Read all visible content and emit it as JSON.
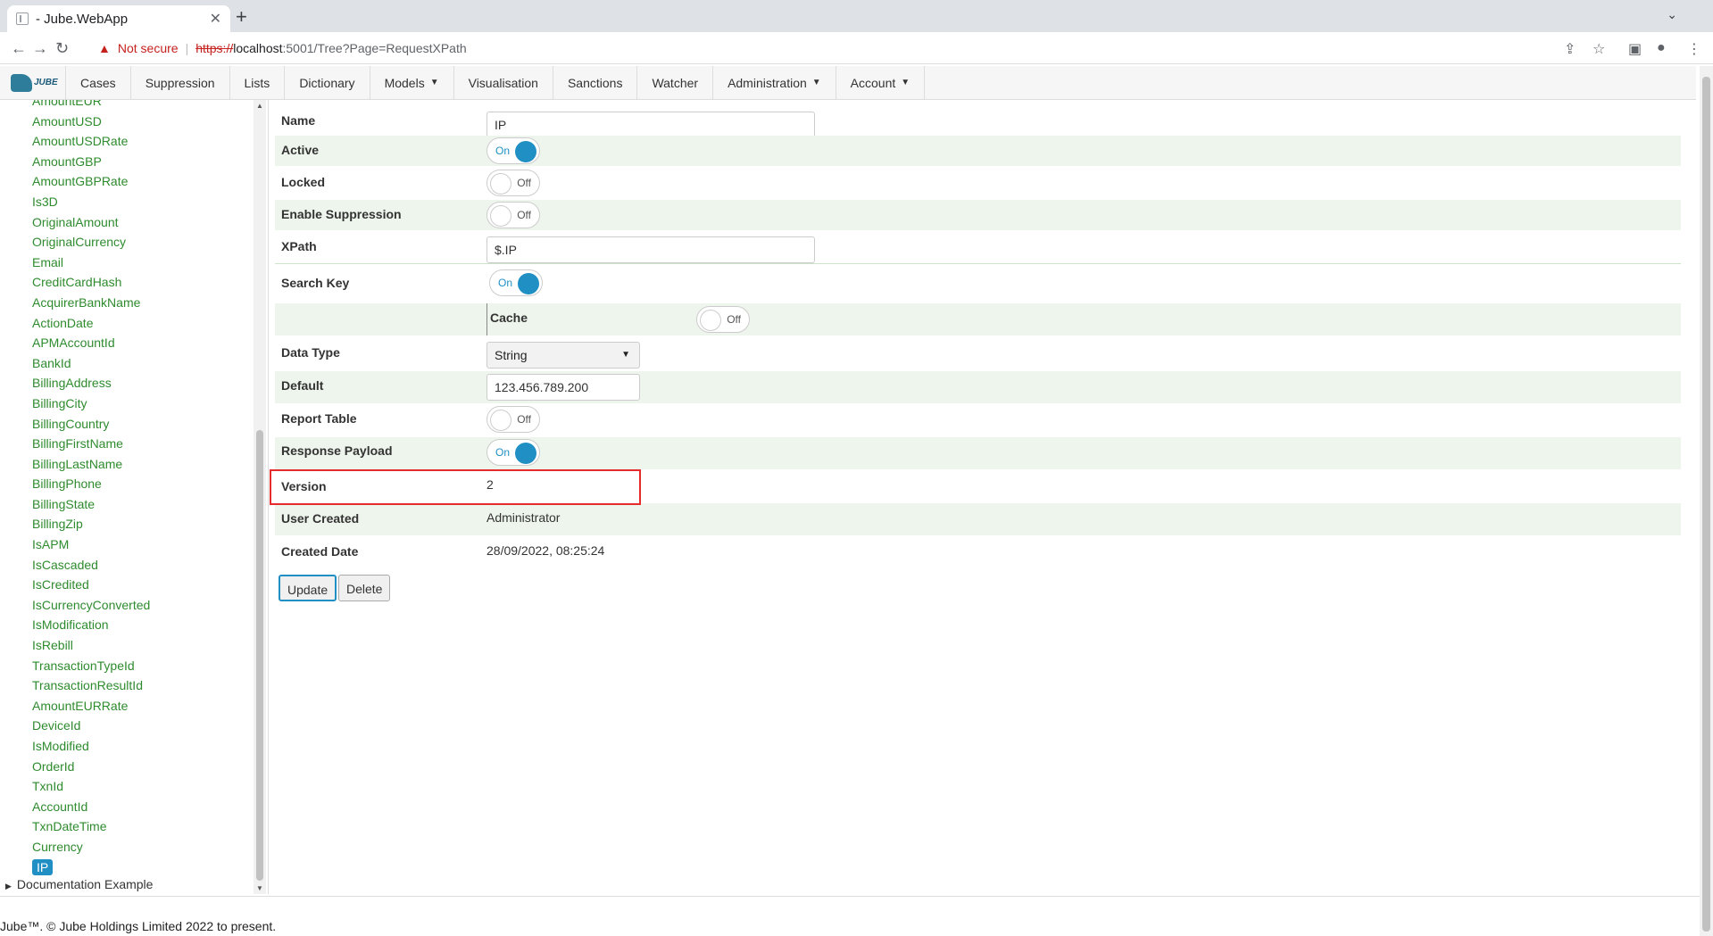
{
  "browser": {
    "tab_title": "- Jube.WebApp",
    "new_tab": "+",
    "not_secure": "Not secure",
    "url_scheme": "https://",
    "url_host": "localhost",
    "url_path": ":5001/Tree?Page=RequestXPath"
  },
  "nav": {
    "logo_text": "JUBE",
    "items": [
      {
        "label": "Cases",
        "dropdown": false
      },
      {
        "label": "Suppression",
        "dropdown": false
      },
      {
        "label": "Lists",
        "dropdown": false
      },
      {
        "label": "Dictionary",
        "dropdown": false
      },
      {
        "label": "Models",
        "dropdown": true
      },
      {
        "label": "Visualisation",
        "dropdown": false
      },
      {
        "label": "Sanctions",
        "dropdown": false
      },
      {
        "label": "Watcher",
        "dropdown": false
      },
      {
        "label": "Administration",
        "dropdown": true
      },
      {
        "label": "Account",
        "dropdown": true
      }
    ]
  },
  "tree": {
    "items": [
      "AmountEUR",
      "AmountUSD",
      "AmountUSDRate",
      "AmountGBP",
      "AmountGBPRate",
      "Is3D",
      "OriginalAmount",
      "OriginalCurrency",
      "Email",
      "CreditCardHash",
      "AcquirerBankName",
      "ActionDate",
      "APMAccountId",
      "BankId",
      "BillingAddress",
      "BillingCity",
      "BillingCountry",
      "BillingFirstName",
      "BillingLastName",
      "BillingPhone",
      "BillingState",
      "BillingZip",
      "IsAPM",
      "IsCascaded",
      "IsCredited",
      "IsCurrencyConverted",
      "IsModification",
      "IsRebill",
      "TransactionTypeId",
      "TransactionResultId",
      "AmountEURRate",
      "DeviceId",
      "IsModified",
      "OrderId",
      "TxnId",
      "AccountId",
      "TxnDateTime",
      "Currency"
    ],
    "selected": "IP",
    "group": "Documentation Example"
  },
  "form": {
    "name_label": "Name",
    "name_value": "IP",
    "active_label": "Active",
    "active_state": "On",
    "locked_label": "Locked",
    "locked_state": "Off",
    "suppression_label": "Enable Suppression",
    "suppression_state": "Off",
    "xpath_label": "XPath",
    "xpath_value": "$.IP",
    "searchkey_label": "Search Key",
    "searchkey_state": "On",
    "cache_label": "Cache",
    "cache_state": "Off",
    "datatype_label": "Data Type",
    "datatype_value": "String",
    "default_label": "Default",
    "default_value": "123.456.789.200",
    "report_label": "Report Table",
    "report_state": "Off",
    "payload_label": "Response Payload",
    "payload_state": "On",
    "version_label": "Version",
    "version_value": "2",
    "user_label": "User Created",
    "user_value": "Administrator",
    "date_label": "Created Date",
    "date_value": "28/09/2022, 08:25:24",
    "update_button": "Update",
    "delete_button": "Delete"
  },
  "footer": "Jube™. © Jube Holdings Limited 2022 to present.",
  "colors": {
    "accent": "#1f8fc4",
    "tree_link": "#2e8b2e",
    "highlight": "#e52b2b",
    "row_shade": "#eef5ec"
  }
}
